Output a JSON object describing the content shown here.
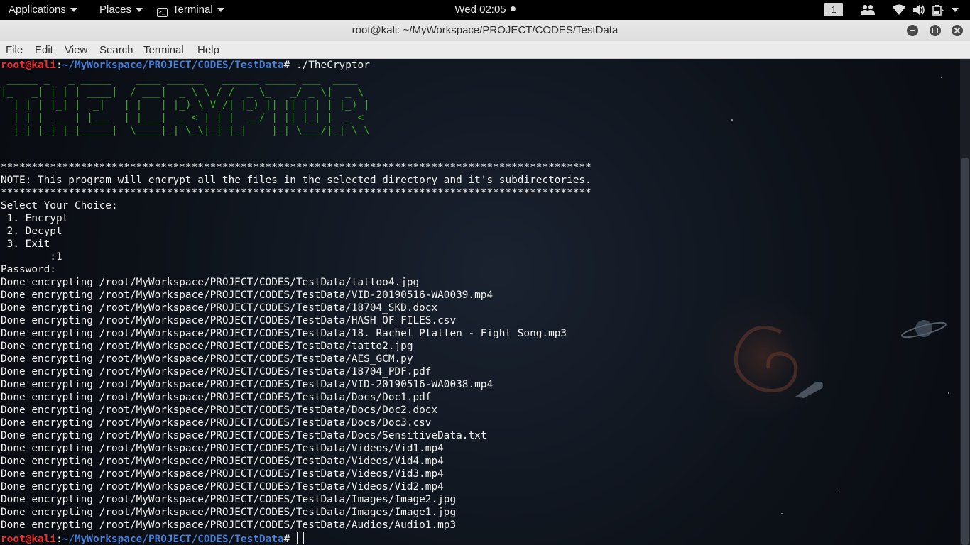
{
  "topbar": {
    "applications": "Applications",
    "places": "Places",
    "terminal": "Terminal",
    "clock": "Wed 02:05",
    "workspace": "1",
    "icons": [
      "people-icon",
      "wifi-icon",
      "volume-icon",
      "battery-icon",
      "chevron-down-icon"
    ]
  },
  "window": {
    "title": "root@kali: ~/MyWorkspace/PROJECT/CODES/TestData",
    "buttons": [
      "minimize",
      "maximize",
      "close"
    ]
  },
  "menubar": {
    "file": "File",
    "edit": "Edit",
    "view": "View",
    "search": "Search",
    "terminal": "Terminal",
    "help": "Help"
  },
  "terminal": {
    "prompt_user": "root@kali",
    "prompt_sep": ":",
    "prompt_path": "~/MyWorkspace/PROJECT/CODES/TestData",
    "prompt_hash": "#",
    "command": " ./TheCryptor",
    "banner": [
      " _____ _   _ _____    ____ ______   ______ _____ ___  ____  ",
      "|_   _| | | | ____|  / ___|  _ \\ \\ / /  _ \\_   _/ _ \\|  _ \\ ",
      "  | | | |_| |  _|   | |   | |_) \\ V /| |_) || || | | | |_) |",
      "  | | |  _  | |___  | |___|  _ < | | |  __/ | || |_| |  _ < ",
      "  |_| |_| |_|_____|  \\____|_| \\_\\|_| |_|    |_| \\___/|_| \\_\\"
    ],
    "stars_line": "************************************************************************************************",
    "note": "NOTE: This program will encrypt all the files in the selected directory and it's subdirectories.",
    "menu_title": "Select Your Choice:",
    "menu_options": [
      " 1. Encrypt",
      " 2. Decypt",
      " 3. Exit"
    ],
    "choice": "        :1",
    "password": "Password:",
    "output_lines": [
      "Done encrypting /root/MyWorkspace/PROJECT/CODES/TestData/tattoo4.jpg",
      "Done encrypting /root/MyWorkspace/PROJECT/CODES/TestData/VID-20190516-WA0039.mp4",
      "Done encrypting /root/MyWorkspace/PROJECT/CODES/TestData/18704_SKD.docx",
      "Done encrypting /root/MyWorkspace/PROJECT/CODES/TestData/HASH_OF_FILES.csv",
      "Done encrypting /root/MyWorkspace/PROJECT/CODES/TestData/18. Rachel Platten - Fight Song.mp3",
      "Done encrypting /root/MyWorkspace/PROJECT/CODES/TestData/tatto2.jpg",
      "Done encrypting /root/MyWorkspace/PROJECT/CODES/TestData/AES_GCM.py",
      "Done encrypting /root/MyWorkspace/PROJECT/CODES/TestData/18704_PDF.pdf",
      "Done encrypting /root/MyWorkspace/PROJECT/CODES/TestData/VID-20190516-WA0038.mp4",
      "Done encrypting /root/MyWorkspace/PROJECT/CODES/TestData/Docs/Doc1.pdf",
      "Done encrypting /root/MyWorkspace/PROJECT/CODES/TestData/Docs/Doc2.docx",
      "Done encrypting /root/MyWorkspace/PROJECT/CODES/TestData/Docs/Doc3.csv",
      "Done encrypting /root/MyWorkspace/PROJECT/CODES/TestData/Docs/SensitiveData.txt",
      "Done encrypting /root/MyWorkspace/PROJECT/CODES/TestData/Videos/Vid1.mp4",
      "Done encrypting /root/MyWorkspace/PROJECT/CODES/TestData/Videos/Vid4.mp4",
      "Done encrypting /root/MyWorkspace/PROJECT/CODES/TestData/Videos/Vid3.mp4",
      "Done encrypting /root/MyWorkspace/PROJECT/CODES/TestData/Videos/Vid2.mp4",
      "Done encrypting /root/MyWorkspace/PROJECT/CODES/TestData/Images/Image2.jpg",
      "Done encrypting /root/MyWorkspace/PROJECT/CODES/TestData/Images/Image1.jpg",
      "Done encrypting /root/MyWorkspace/PROJECT/CODES/TestData/Audios/Audio1.mp3"
    ],
    "colors": {
      "prompt_user": "#ef2d2d",
      "prompt_path": "#4a7fd6",
      "banner": "#3aa62a",
      "text": "#f2f2f2"
    }
  }
}
